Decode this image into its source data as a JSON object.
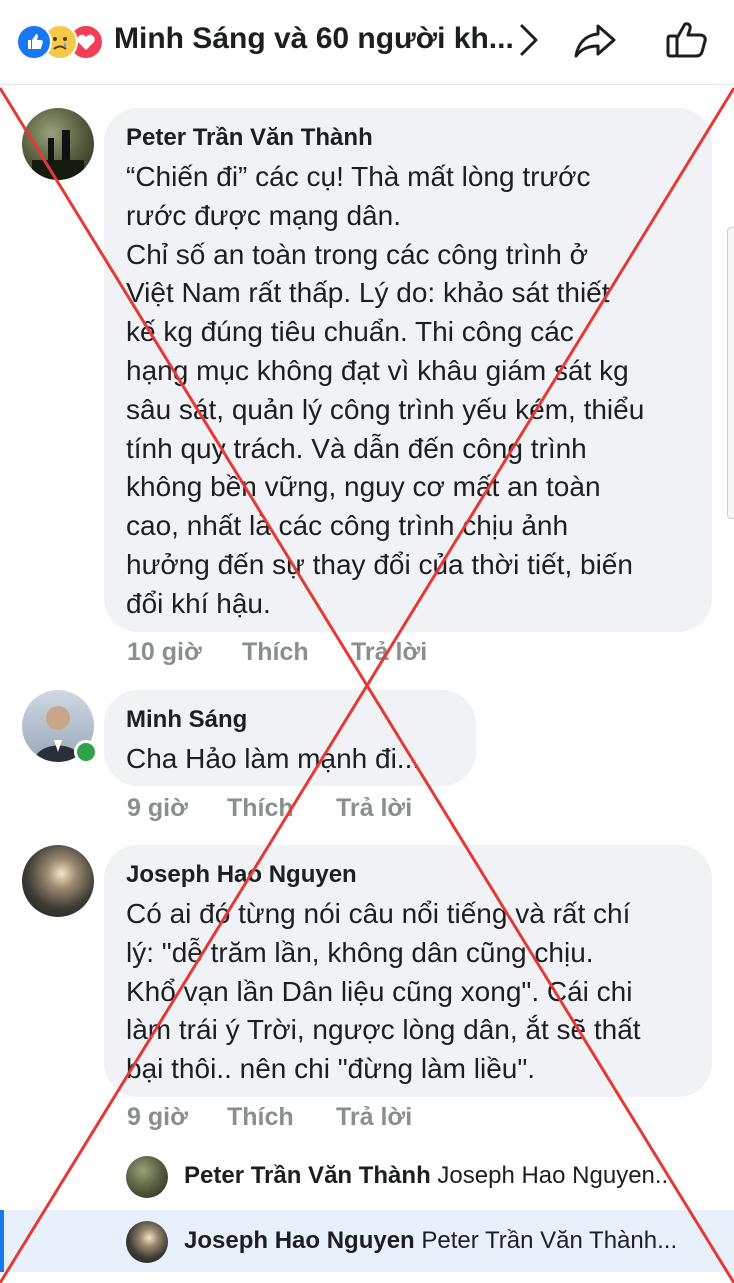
{
  "header": {
    "title": "Minh Sáng và 60 người kh...",
    "reaction_icons": [
      "like-icon",
      "sad-icon",
      "love-icon"
    ],
    "chevron": "chevron-right-icon",
    "share": "share-icon",
    "like": "thumbs-up-icon"
  },
  "comments": [
    {
      "author": "Peter Trần Văn Thành",
      "text": "“Chiến đi” các cụ! Thà mất lòng trước\nrước được mạng dân.\nChỉ số an toàn trong các công trình ở\nViệt Nam rất thấp. Lý do: khảo sát thiết\nkế kg đúng tiêu chuẩn. Thi công các\nhạng mục không đạt vì khâu giám sát kg\nsâu sát, quản lý công trình yếu kém, thiểu\ntính quy trách. Và dẫn đến công trình\nkhông bền vững, nguy cơ mất an toàn\ncao, nhất là các công trình chịu ảnh\nhưởng đến sự thay đổi của thời tiết, biến\nđổi khí hậu.",
      "time": "10 giờ",
      "like_label": "Thích",
      "reply_label": "Trả lời"
    },
    {
      "author": "Minh Sáng",
      "text": "Cha Hảo làm mạnh đi...",
      "time": "9 giờ",
      "like_label": "Thích",
      "reply_label": "Trả lời"
    },
    {
      "author": "Joseph Hao Nguyen",
      "text": "Có ai đó từng nói câu nổi tiếng và rất chí\nlý: \"dễ trăm lần, không dân cũng chịu.\nKhổ vạn lần Dân liệu cũng xong\". Cái chi\nlàm trái ý Trời, ngược lòng dân, ắt sẽ thất\nbại thôi.. nên chi \"đừng làm liều\".",
      "time": "9 giờ",
      "like_label": "Thích",
      "reply_label": "Trả lời"
    }
  ],
  "replies": [
    {
      "author": "Peter Trần Văn Thành",
      "preview": "Joseph Hao Nguyen..."
    },
    {
      "author": "Joseph Hao Nguyen",
      "preview": "Peter Trần Văn Thành..."
    }
  ],
  "colors": {
    "bubble": "#f0f2f5",
    "meta_text": "#8a8d91",
    "online": "#31a24c",
    "cross_overlay": "#e53935",
    "accent": "#1877f2"
  }
}
